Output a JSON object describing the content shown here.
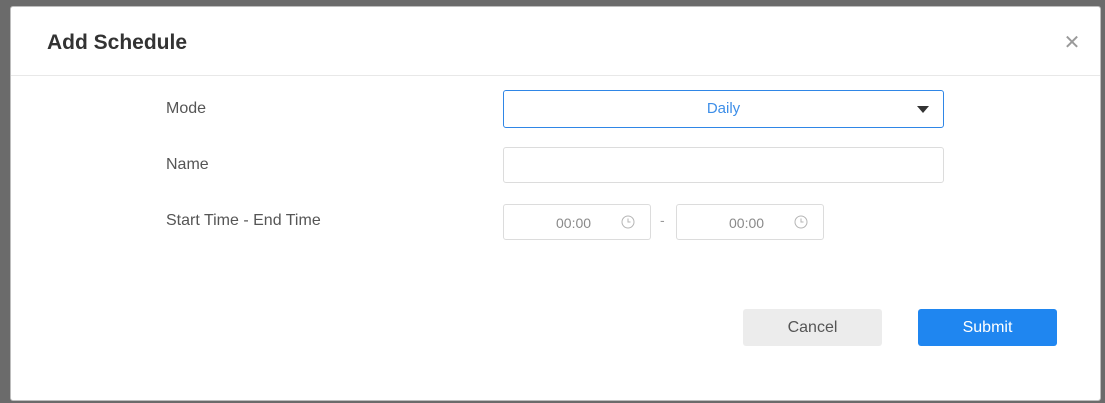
{
  "dialog": {
    "title": "Add Schedule",
    "close_icon": "close-icon"
  },
  "form": {
    "mode_label": "Mode",
    "mode_value": "Daily",
    "name_label": "Name",
    "name_value": "",
    "time_label": "Start Time - End Time",
    "start_time": "00:00",
    "end_time": "00:00",
    "time_separator": "-"
  },
  "buttons": {
    "cancel": "Cancel",
    "submit": "Submit"
  },
  "colors": {
    "accent": "#1f86f0",
    "select_text": "#3d8ee8"
  }
}
